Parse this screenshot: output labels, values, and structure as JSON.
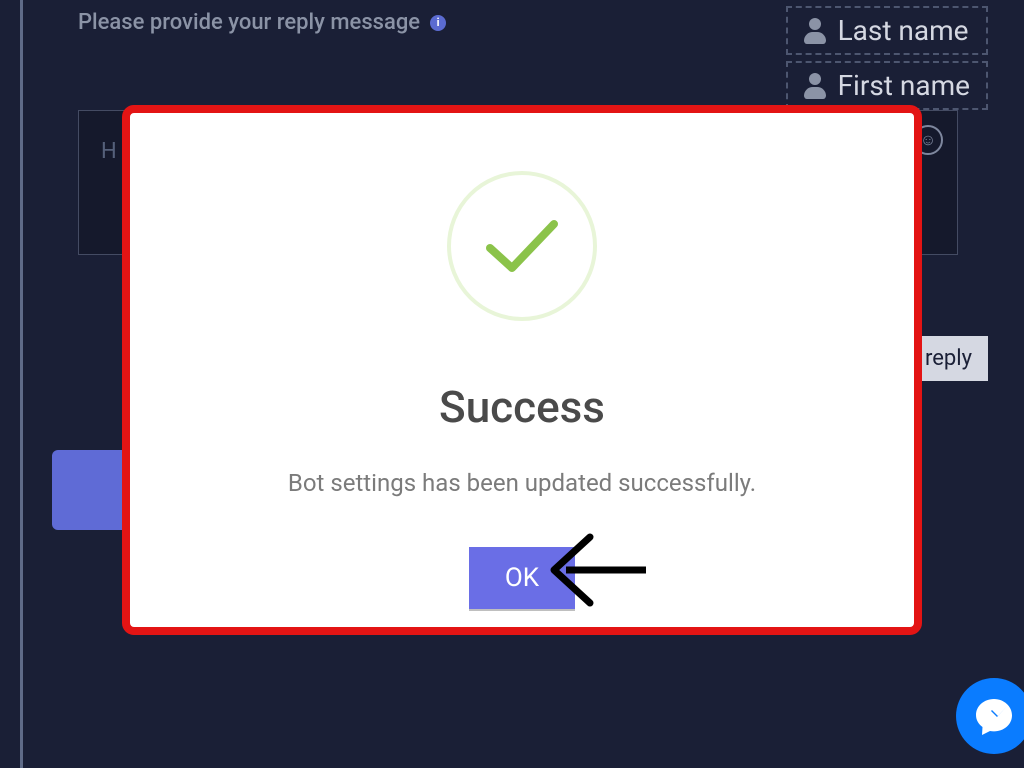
{
  "background": {
    "reply_label": "Please provide your reply message",
    "text_hint": "H",
    "chips": {
      "last": "Last name",
      "first": "First name"
    },
    "add_reply": "reply"
  },
  "modal": {
    "title": "Success",
    "message": "Bot settings has been updated successfully.",
    "ok_label": "OK"
  },
  "colors": {
    "accent": "#6a6ee6",
    "annotation": "#e31414",
    "success_ring": "#e8f5d8",
    "check": "#8bc34a",
    "chat": "#0a7cff"
  }
}
